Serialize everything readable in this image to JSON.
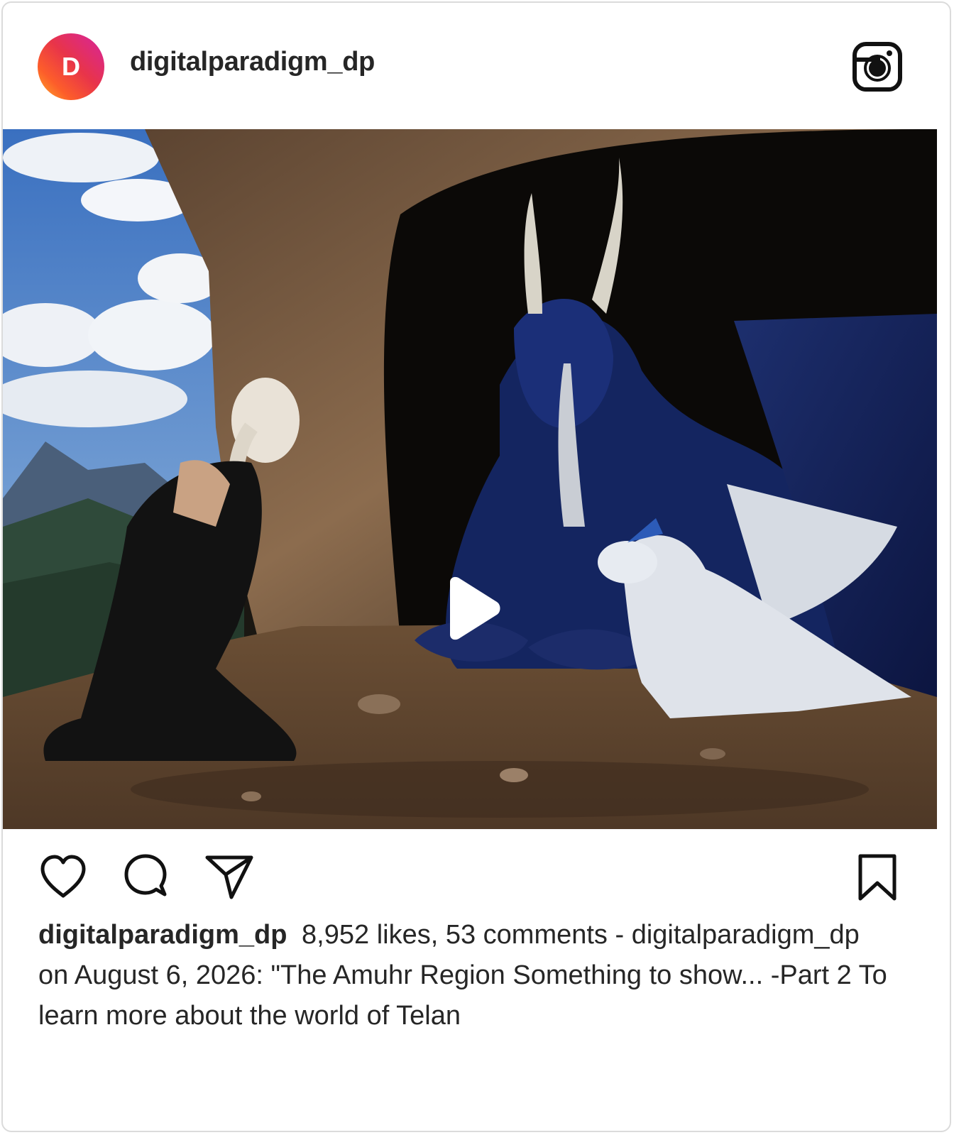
{
  "post": {
    "avatar_letter": "D",
    "username": "digitalparadigm_dp",
    "media_type": "video",
    "caption": {
      "username": "digitalparadigm_dp",
      "text": "8,952 likes, 53 comments - digitalparadigm_dp on August 6, 2026: \"The Amuhr Region Something to show... -Part 2 To learn more about the world of Telan"
    }
  },
  "icons": {
    "header_right": "instagram-icon",
    "play": "play-icon",
    "like": "heart-icon",
    "comment": "comment-icon",
    "share": "send-icon",
    "save": "bookmark-icon"
  },
  "colors": {
    "text": "#262626",
    "border": "#dbdbdb",
    "avatar_gradient_start": "#d6249f",
    "avatar_gradient_end": "#feb02b"
  }
}
